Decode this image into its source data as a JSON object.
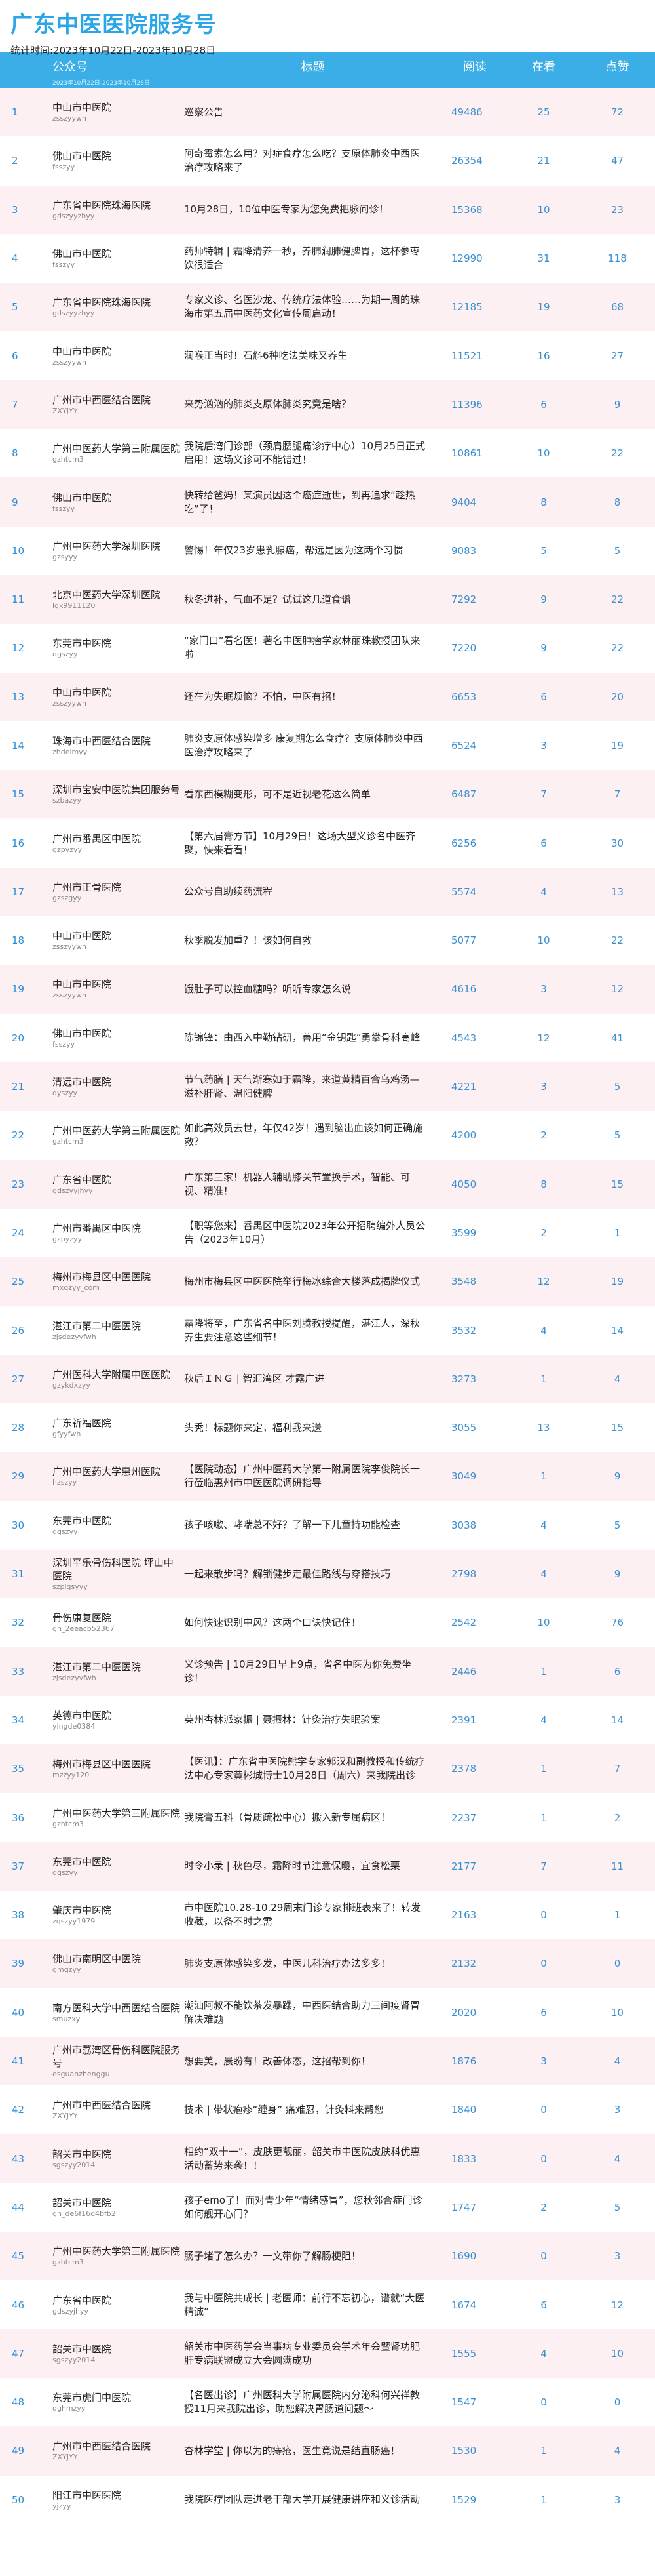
{
  "header": {
    "title": "广东中医医院服务号",
    "date_range": "统计时间:2023年10月22日-2023年10月28日"
  },
  "columns": [
    "公众号",
    "标题",
    "阅读",
    "在看",
    "点赞"
  ],
  "subheader_note": "2023年10月22日-2023年10月28日",
  "rows": [
    {
      "idx": "1",
      "name": "中山市中医院",
      "id": "zsszyywh",
      "title": "巡察公告",
      "read": "49486",
      "look": "25",
      "like": "72"
    },
    {
      "idx": "2",
      "name": "佛山市中医院",
      "id": "fsszyy",
      "title": "阿奇霉素怎么用？对症食疗怎么吃？支原体肺炎中西医治疗攻略来了",
      "read": "26354",
      "look": "21",
      "like": "47"
    },
    {
      "idx": "3",
      "name": "广东省中医院珠海医院",
      "id": "gdszyyzhyy",
      "title": "10月28日，10位中医专家为您免费把脉问诊！",
      "read": "15368",
      "look": "10",
      "like": "23"
    },
    {
      "idx": "4",
      "name": "佛山市中医院",
      "id": "fsszyy",
      "title": "药师特辑 | 霜降清养一秒，养肺润肺健脾胃，这杯参枣饮很适合",
      "read": "12990",
      "look": "31",
      "like": "118"
    },
    {
      "idx": "5",
      "name": "广东省中医院珠海医院",
      "id": "gdszyyzhyy",
      "title": "专家义诊、名医沙龙、传统疗法体验……为期一周的珠海市第五届中医药文化宣传周启动！",
      "read": "12185",
      "look": "19",
      "like": "68"
    },
    {
      "idx": "6",
      "name": "中山市中医院",
      "id": "zsszyywh",
      "title": "润喉正当时！石斛6种吃法美味又养生",
      "read": "11521",
      "look": "16",
      "like": "27"
    },
    {
      "idx": "7",
      "name": "广州市中西医结合医院",
      "id": "ZXYJYY",
      "title": "来势汹汹的肺炎支原体肺炎究竟是啥？",
      "read": "11396",
      "look": "6",
      "like": "9"
    },
    {
      "idx": "8",
      "name": "广州中医药大学第三附属医院",
      "id": "gzhtcm3",
      "title": "我院后湾门诊部（颈肩腰腿痛诊疗中心）10月25日正式启用！这场义诊可不能错过！",
      "read": "10861",
      "look": "10",
      "like": "22"
    },
    {
      "idx": "9",
      "name": "佛山市中医院",
      "id": "fsszyy",
      "title": "快转给爸妈！某演员因这个癌症逝世，到再追求“趁热吃”了！",
      "read": "9404",
      "look": "8",
      "like": "8"
    },
    {
      "idx": "10",
      "name": "广州中医药大学深圳医院",
      "id": "gzsyyy",
      "title": "警惕！年仅23岁患乳腺癌，帮远是因为这两个习惯",
      "read": "9083",
      "look": "5",
      "like": "5"
    },
    {
      "idx": "11",
      "name": "北京中医药大学深圳医院",
      "id": "lgk9911120",
      "title": "秋冬进补，气血不足？试试这几道食谱",
      "read": "7292",
      "look": "9",
      "like": "22"
    },
    {
      "idx": "12",
      "name": "东莞市中医院",
      "id": "dgszyy",
      "title": "“家门口”看名医！著名中医肿瘤学家林丽珠教授团队来啦",
      "read": "7220",
      "look": "9",
      "like": "22"
    },
    {
      "idx": "13",
      "name": "中山市中医院",
      "id": "zsszyywh",
      "title": "还在为失眠烦恼？不怕，中医有招！",
      "read": "6653",
      "look": "6",
      "like": "20"
    },
    {
      "idx": "14",
      "name": "珠海市中西医结合医院",
      "id": "zhdelmyy",
      "title": "肺炎支原体感染增多 康复期怎么食疗？支原体肺炎中西医治疗攻略来了",
      "read": "6524",
      "look": "3",
      "like": "19"
    },
    {
      "idx": "15",
      "name": "深圳市宝安中医院集团服务号",
      "id": "szbazyy",
      "title": "看东西模糊变形，可不是近视老花这么简单",
      "read": "6487",
      "look": "7",
      "like": "7"
    },
    {
      "idx": "16",
      "name": "广州市番禺区中医院",
      "id": "gzpyzyy",
      "title": "【第六届膏方节】10月29日！这场大型义诊名中医齐聚，快来看看！",
      "read": "6256",
      "look": "6",
      "like": "30"
    },
    {
      "idx": "17",
      "name": "广州市正骨医院",
      "id": "gzszgyy",
      "title": "公众号自助续药流程",
      "read": "5574",
      "look": "4",
      "like": "13"
    },
    {
      "idx": "18",
      "name": "中山市中医院",
      "id": "zsszyywh",
      "title": "秋季脱发加重？！该如何自救",
      "read": "5077",
      "look": "10",
      "like": "22"
    },
    {
      "idx": "19",
      "name": "中山市中医院",
      "id": "zsszyywh",
      "title": "饿肚子可以控血糖吗？听听专家怎么说",
      "read": "4616",
      "look": "3",
      "like": "12"
    },
    {
      "idx": "20",
      "name": "佛山市中医院",
      "id": "fsszyy",
      "title": "陈锦锋：由西入中勤钻研，善用“金钥匙”勇攀骨科高峰",
      "read": "4543",
      "look": "12",
      "like": "41"
    },
    {
      "idx": "21",
      "name": "清远市中医院",
      "id": "qyszyy",
      "title": "节气药膳 | 天气渐寒如于霜降，来道黄精百合乌鸡汤—滋补肝肾、温阳健脾",
      "read": "4221",
      "look": "3",
      "like": "5"
    },
    {
      "idx": "22",
      "name": "广州中医药大学第三附属医院",
      "id": "gzhtcm3",
      "title": "如此高效员去世，年仅42岁！遇到脑出血该如何正确施救？",
      "read": "4200",
      "look": "2",
      "like": "5"
    },
    {
      "idx": "23",
      "name": "广东省中医院",
      "id": "gdszyyjhyy",
      "title": "广东第三家！机器人辅助膝关节置换手术，智能、可视、精准！",
      "read": "4050",
      "look": "8",
      "like": "15"
    },
    {
      "idx": "24",
      "name": "广州市番禺区中医院",
      "id": "gzpyzyy",
      "title": "【职等您来】番禺区中医院2023年公开招聘编外人员公告（2023年10月）",
      "read": "3599",
      "look": "2",
      "like": "1"
    },
    {
      "idx": "25",
      "name": "梅州市梅县区中医医院",
      "id": "mxqzyy_com",
      "title": "梅州市梅县区中医医院举行梅冰综合大楼落成揭牌仪式",
      "read": "3548",
      "look": "12",
      "like": "19"
    },
    {
      "idx": "26",
      "name": "湛江市第二中医医院",
      "id": "zjsdezyyfwh",
      "title": "霜降将至，广东省名中医刘腾教授提醒，湛江人，深秋养生要注意这些细节！",
      "read": "3532",
      "look": "4",
      "like": "14"
    },
    {
      "idx": "27",
      "name": "广州医科大学附属中医医院",
      "id": "gzykdxzyy",
      "title": "秋后ＩＮＧ | 智汇湾区 才露广进",
      "read": "3273",
      "look": "1",
      "like": "4"
    },
    {
      "idx": "28",
      "name": "广东祈福医院",
      "id": "gfyyfwh",
      "title": "头秃！标题你来定，福利我来送",
      "read": "3055",
      "look": "13",
      "like": "15"
    },
    {
      "idx": "29",
      "name": "广州中医药大学惠州医院",
      "id": "hzszyy",
      "title": "【医院动态】广州中医药大学第一附属医院李俊院长一行莅临惠州市中医医院调研指导",
      "read": "3049",
      "look": "1",
      "like": "9"
    },
    {
      "idx": "30",
      "name": "东莞市中医院",
      "id": "dgszyy",
      "title": "孩子咳嗽、哮喘总不好？了解一下儿童持功能检查",
      "read": "3038",
      "look": "4",
      "like": "5"
    },
    {
      "idx": "31",
      "name": "深圳平乐骨伤科医院 坪山中医院",
      "id": "szplgsyyy",
      "title": "一起来散步吗？解锁健步走最佳路线与穿搭技巧",
      "read": "2798",
      "look": "4",
      "like": "9"
    },
    {
      "idx": "32",
      "name": "骨伤康复医院",
      "id": "gh_2eeacb52367",
      "title": "如何快速识别中风？这两个口诀快记住！",
      "read": "2542",
      "look": "10",
      "like": "76"
    },
    {
      "idx": "33",
      "name": "湛江市第二中医医院",
      "id": "zjsdezyyfwh",
      "title": "义诊预告 | 10月29日早上9点，省名中医为你免费坐诊！",
      "read": "2446",
      "look": "1",
      "like": "6"
    },
    {
      "idx": "34",
      "name": "英德市中医院",
      "id": "yingde0384",
      "title": "英州杏林派家振 | 聂振林：针灸治疗失眠验案",
      "read": "2391",
      "look": "4",
      "like": "14"
    },
    {
      "idx": "35",
      "name": "梅州市梅县区中医医院",
      "id": "mzzyy120",
      "title": "【医讯】：广东省中医院熊学专家郭汉和副教授和传统疗法中心专家黄彬城博士10月28日（周六）来我院出诊",
      "read": "2378",
      "look": "1",
      "like": "7"
    },
    {
      "idx": "36",
      "name": "广州中医药大学第三附属医院",
      "id": "gzhtcm3",
      "title": "我院膏五科（骨质疏松中心）搬入新专属病区！",
      "read": "2237",
      "look": "1",
      "like": "2"
    },
    {
      "idx": "37",
      "name": "东莞市中医院",
      "id": "dgszyy",
      "title": "时令小录 | 秋色尽，霜降时节注意保暖，宜食松栗",
      "read": "2177",
      "look": "7",
      "like": "11"
    },
    {
      "idx": "38",
      "name": "肇庆市中医院",
      "id": "zqszyy1979",
      "title": "市中医院10.28-10.29周末门诊专家排班表来了！转发收藏，以备不时之需",
      "read": "2163",
      "look": "0",
      "like": "1"
    },
    {
      "idx": "39",
      "name": "佛山市南明区中医院",
      "id": "gmqzyy",
      "title": "肺炎支原体感染多发，中医儿科治疗办法多多！",
      "read": "2132",
      "look": "0",
      "like": "0"
    },
    {
      "idx": "40",
      "name": "南方医科大学中西医结合医院",
      "id": "smuzxy",
      "title": "潮汕阿叔不能饮茶发暴躁，中西医结合助力三间疫肾冒解决难题",
      "read": "2020",
      "look": "6",
      "like": "10"
    },
    {
      "idx": "41",
      "name": "广州市荔湾区骨伤科医院服务号",
      "id": "esguanzhenggu",
      "title": "想要美，晨盼有！改善体态，这招帮到你！",
      "read": "1876",
      "look": "3",
      "like": "4"
    },
    {
      "idx": "42",
      "name": "广州市中西医结合医院",
      "id": "ZXYJYY",
      "title": "技术 | 带状疱疹“缠身” 痛难忍，针灸料来帮您",
      "read": "1840",
      "look": "0",
      "like": "3"
    },
    {
      "idx": "43",
      "name": "韶关市中医院",
      "id": "sgszyy2014",
      "title": "相约“双十一”，皮肤更靓丽，韶关市中医院皮肤科优惠活动蓄势来袭！！",
      "read": "1833",
      "look": "0",
      "like": "4"
    },
    {
      "idx": "44",
      "name": "韶关市中医院",
      "id": "gh_de6f16d4bfb2",
      "title": "孩子emo了！面对青少年“情绪感冒”，您秋邻合症门诊如何舰开心门？",
      "read": "1747",
      "look": "2",
      "like": "5"
    },
    {
      "idx": "45",
      "name": "广州中医药大学第三附属医院",
      "id": "gzhtcm3",
      "title": "肠子堵了怎么办？一文带你了解肠梗阻！",
      "read": "1690",
      "look": "0",
      "like": "3"
    },
    {
      "idx": "46",
      "name": "广东省中医院",
      "id": "gdszyjhyy",
      "title": "我与中医院共成长 | 老医师：前行不忘初心，谱就“大医精诚”",
      "read": "1674",
      "look": "6",
      "like": "12"
    },
    {
      "idx": "47",
      "name": "韶关市中医院",
      "id": "sgszyy2014",
      "title": "韶关市中医药学会当事病专业委员会学术年会暨肾功肥肝专病联盟成立大会圆满成功",
      "read": "1555",
      "look": "4",
      "like": "10"
    },
    {
      "idx": "48",
      "name": "东莞市虎门中医院",
      "id": "dghmzyy",
      "title": "【名医出诊】广州医科大学附属医院内分泌科何兴祥教授11月来我院出诊，助您解决胃肠道问题～",
      "read": "1547",
      "look": "0",
      "like": "0"
    },
    {
      "idx": "49",
      "name": "广州市中西医结合医院",
      "id": "ZXYJYY",
      "title": "杏林学堂 | 你以为的痔疮，医生竟说是结直肠癌！",
      "read": "1530",
      "look": "1",
      "like": "4"
    },
    {
      "idx": "50",
      "name": "阳江市中医医院",
      "id": "yjzyy",
      "title": "我院医疗团队走进老干部大学开展健康讲座和义诊活动",
      "read": "1529",
      "look": "1",
      "like": "3"
    }
  ]
}
